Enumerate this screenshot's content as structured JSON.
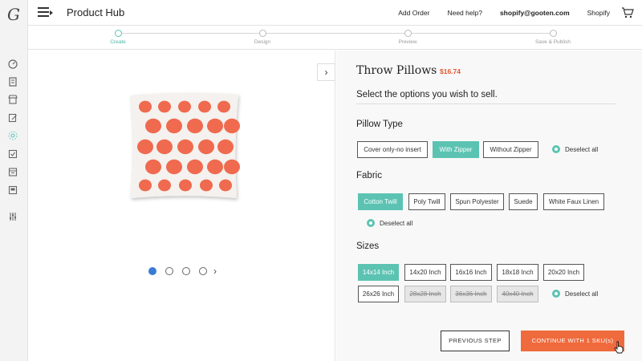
{
  "app": {
    "title": "Product Hub"
  },
  "topnav": {
    "add_order": "Add Order",
    "help": "Need help?",
    "email": "shopify@gooten.com",
    "store": "Shopify"
  },
  "steps": [
    {
      "label": "Create",
      "active": true
    },
    {
      "label": "Design",
      "active": false
    },
    {
      "label": "Preview",
      "active": false
    },
    {
      "label": "Save & Publish",
      "active": false
    }
  ],
  "product": {
    "title": "Throw Pillows",
    "price": "$16.74"
  },
  "prompt": "Select the options you wish to sell.",
  "pillow_type": {
    "title": "Pillow Type",
    "options": [
      {
        "label": "Cover only-no insert",
        "selected": false,
        "disabled": false
      },
      {
        "label": "With Zipper",
        "selected": true,
        "disabled": false
      },
      {
        "label": "Without Zipper",
        "selected": false,
        "disabled": false
      }
    ],
    "deselect": "Deselect all"
  },
  "fabric": {
    "title": "Fabric",
    "options": [
      {
        "label": "Cotton Twill",
        "selected": true,
        "disabled": false
      },
      {
        "label": "Poly Twill",
        "selected": false,
        "disabled": false
      },
      {
        "label": "Spun Polyester",
        "selected": false,
        "disabled": false
      },
      {
        "label": "Suede",
        "selected": false,
        "disabled": false
      },
      {
        "label": "White Faux Linen",
        "selected": false,
        "disabled": false
      }
    ],
    "deselect": "Deselect all"
  },
  "sizes": {
    "title": "Sizes",
    "options": [
      {
        "label": "14x14 Inch",
        "selected": true,
        "disabled": false
      },
      {
        "label": "14x20 Inch",
        "selected": false,
        "disabled": false
      },
      {
        "label": "16x16 Inch",
        "selected": false,
        "disabled": false
      },
      {
        "label": "18x18 Inch",
        "selected": false,
        "disabled": false
      },
      {
        "label": "20x20 Inch",
        "selected": false,
        "disabled": false
      },
      {
        "label": "26x26 Inch",
        "selected": false,
        "disabled": false
      },
      {
        "label": "28x28 Inch",
        "selected": false,
        "disabled": true
      },
      {
        "label": "36x36 Inch",
        "selected": false,
        "disabled": true
      },
      {
        "label": "40x40 Inch",
        "selected": false,
        "disabled": true
      }
    ],
    "deselect": "Deselect all"
  },
  "actions": {
    "previous": "PREVIOUS STEP",
    "continue": "CONTINUE WITH 1 SKU(s)"
  },
  "carousel": {
    "total": 4,
    "current": 1
  },
  "colors": {
    "accent_teal": "#5cc3b3",
    "accent_orange": "#ef6a3c",
    "price_red": "#e4572e",
    "pillow_dot": "#ef6a4f"
  },
  "rail_icons": [
    "dashboard-icon",
    "orders-icon",
    "store-icon",
    "edit-icon",
    "hub-icon",
    "checklist-icon",
    "calendar-icon",
    "archive-icon",
    "settings-sliders-icon"
  ]
}
